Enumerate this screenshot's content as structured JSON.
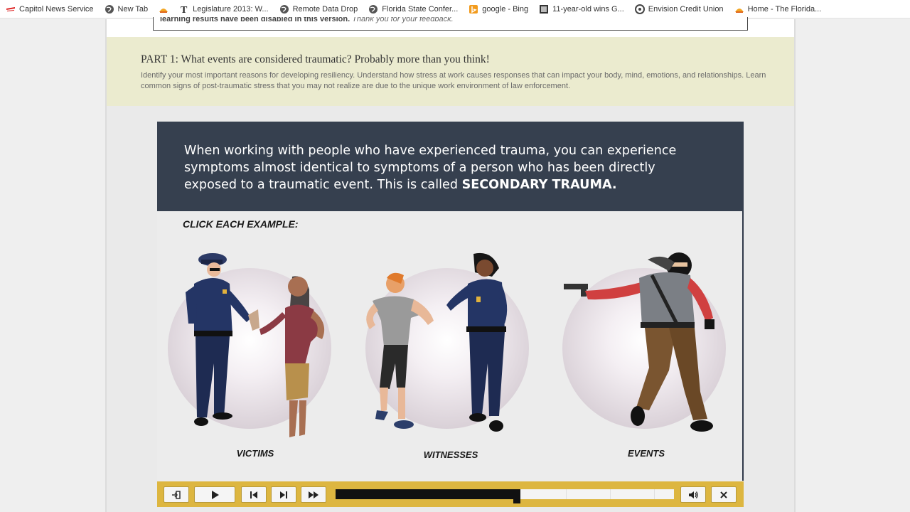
{
  "bookmarks": [
    {
      "label": "Capitol News Service",
      "icon": "red-swoosh-icon"
    },
    {
      "label": "New Tab",
      "icon": "globe-icon"
    },
    {
      "label": "",
      "icon": "sunrise-icon"
    },
    {
      "label": "Legislature 2013: W...",
      "icon": "t-logo-icon"
    },
    {
      "label": "Remote Data Drop",
      "icon": "globe-icon"
    },
    {
      "label": "Florida State Confer...",
      "icon": "globe-icon"
    },
    {
      "label": "google - Bing",
      "icon": "bing-icon"
    },
    {
      "label": "11-year-old wins G...",
      "icon": "news-icon"
    },
    {
      "label": "Envision Credit Union",
      "icon": "envision-icon"
    },
    {
      "label": "Home - The Florida...",
      "icon": "sunrise-icon"
    }
  ],
  "feedback": {
    "bold_text": "learning results have been disabled in this version.",
    "italic_text": "Thank you for your feedback."
  },
  "part": {
    "title": "PART 1: What events are considered traumatic? Probably more than you think!",
    "description": "Identify your most important reasons for developing resiliency. Understand how stress at work causes responses that can impact your body, mind, emotions, and relationships. Learn common signs of post-traumatic stress that you may not realize are due to the unique work environment of law enforcement."
  },
  "slide": {
    "header_text": "When working with people who have experienced trauma, you can experience symptoms almost identical to symptoms of a person who has been directly exposed to a traumatic event. This is called ",
    "header_bold": "SECONDARY TRAUMA.",
    "instruction": "CLICK EACH EXAMPLE:",
    "examples": [
      {
        "label": "VICTIMS",
        "icon": "officer-with-victim-illustration"
      },
      {
        "label": "WITNESSES",
        "icon": "officer-with-witness-illustration"
      },
      {
        "label": "EVENTS",
        "icon": "armed-suspect-illustration"
      }
    ]
  },
  "player": {
    "progress": 0.53,
    "buttons": [
      "exit",
      "play",
      "previous",
      "next",
      "fast-forward",
      "volume",
      "close"
    ]
  },
  "colors": {
    "header_bg": "#36404f",
    "banner_bg": "#ebebcf",
    "player_bg": "#ddb640"
  }
}
